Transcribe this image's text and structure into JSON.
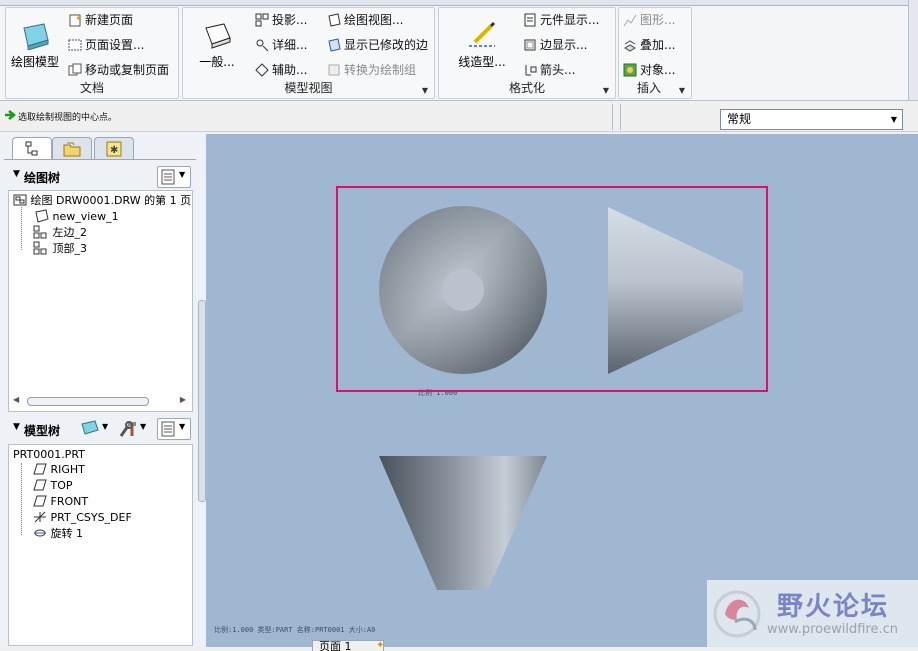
{
  "ribbon": {
    "document_group": {
      "label": "文档",
      "big_button": "绘图模型",
      "items": [
        "新建页面",
        "页面设置...",
        "移动或复制页面"
      ]
    },
    "model_view_group": {
      "label": "模型视图",
      "big_button": "一般...",
      "col1": [
        "投影...",
        "详细...",
        "辅助..."
      ],
      "col2": [
        "绘图视图...",
        "显示已修改的边",
        "转换为绘制组"
      ]
    },
    "format_group": {
      "label": "格式化",
      "big_button": "线造型...",
      "items": [
        "元件显示...",
        "边显示...",
        "箭头..."
      ]
    },
    "insert_group": {
      "label": "插入",
      "items": [
        "图形...",
        "叠加...",
        "对象..."
      ]
    }
  },
  "status": {
    "message": "选取绘制视图的中心点。",
    "display_style": "常规"
  },
  "drawing_tree": {
    "title": "绘图树",
    "root": "绘图 DRW0001.DRW 的第 1 页",
    "items": [
      "new_view_1",
      "左边_2",
      "顶部_3"
    ]
  },
  "model_tree": {
    "title": "模型树",
    "root": "PRT0001.PRT",
    "items": [
      "RIGHT",
      "TOP",
      "FRONT",
      "PRT_CSYS_DEF",
      "旋转 1"
    ]
  },
  "canvas": {
    "view_scale_note": "比例 1.000",
    "footer_note": "比例:1.000   类型:PART   名称:PRT0001   大小:A0",
    "bottom_tabs": [
      "页面 1"
    ]
  },
  "watermark": {
    "title": "野火论坛",
    "url": "www.proewildfire.cn"
  }
}
